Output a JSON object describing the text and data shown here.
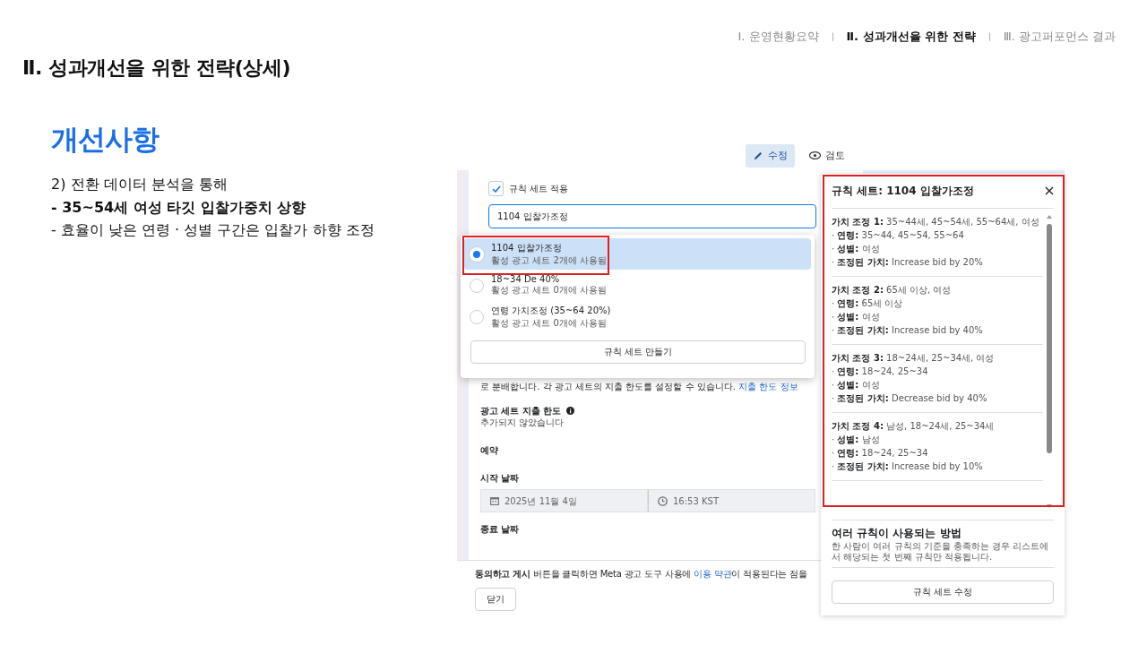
{
  "nav": {
    "items": [
      {
        "label": "Ⅰ. 운영현황요약",
        "selected": false
      },
      {
        "label": "Ⅱ. 성과개선을 위한 전략",
        "selected": true
      },
      {
        "label": "Ⅲ. 광고퍼포먼스 결과",
        "selected": false
      }
    ],
    "separators": [
      "ㅣ",
      "ㅣ"
    ]
  },
  "title": "Ⅱ. 성과개선을 위한 전략(상세)",
  "section": {
    "heading": "개선사항",
    "points": [
      {
        "kind": "lead",
        "text": "2) 전환 데이터 분석을 통해"
      },
      {
        "kind": "strong",
        "text": "- 35~54세 여성 타깃 입찰가중치 상향"
      },
      {
        "kind": "plain",
        "text": "- 효율이 낮은 연령 · 성별 구간은 입찰가 하향 조정"
      }
    ]
  },
  "screen": {
    "mode_tabs": [
      {
        "label": "수정",
        "selected": true
      },
      {
        "label": "검토",
        "selected": false
      }
    ],
    "form": {
      "apply_rule_set": {
        "label": "규칙 세트 적용",
        "checked": true
      },
      "rule_set_field": {
        "value": "1104 입찰가조정"
      },
      "budget_note": "로 분배합니다. 각 광고 세트의 지출 한도를 설정할 수 있습니다. ",
      "budget_link": "지출 한도 정보",
      "spend_limit": {
        "label": "광고 세트 지출 한도",
        "value": "추가되지 않았습니다"
      },
      "schedule_heading": "예약",
      "start_label": "시작 날짜",
      "start_date": "2025년 11월 4일",
      "start_time": "16:53  KST",
      "end_label": "종료 날짜"
    },
    "footer": {
      "notice": "**동의하고 게시** 버튼을 클릭하면 Meta 광고 도구 사용에 ",
      "terms_link": "이용 약관",
      "notice_end": "이 적용된다는 점을",
      "close_button": "닫기"
    },
    "dropdown": {
      "options": [
        {
          "title": "1104 입찰가조정",
          "subtitle": "활성 광고 세트 2개에 사용됨",
          "selected": true
        },
        {
          "title": "18~34 De 40%",
          "subtitle": "활성 광고 세트 0개에 사용됨",
          "selected": false
        },
        {
          "title": "연령 가치조정 (35~64 20%)",
          "subtitle": "활성 광고 세트 0개에 사용됨",
          "selected": false
        }
      ],
      "create_button": "규칙 세트 만들기"
    },
    "panel": {
      "title": "규칙 세트: 1104 입찰가조정",
      "adjustments": [
        {
          "title": "**가치 조정 1:** 35~44세, 45~54세, 55~64세, 여성",
          "lines": [
            "· **연령:** 35~44, 45~54, 55~64",
            "· **성별:** 여성",
            "· **조정된 가치:** Increase bid by 20%"
          ]
        },
        {
          "title": "**가치 조정 2:** 65세 이상, 여성",
          "lines": [
            "· **연령:** 65세 이상",
            "· **성별:** 여성",
            "· **조정된 가치:** Increase bid by 40%"
          ]
        },
        {
          "title": "**가치 조정 3:** 18~24세, 25~34세, 여성",
          "lines": [
            "· **연령:** 18~24, 25~34",
            "· **성별:** 여성",
            "· **조정된 가치:** Decrease bid by 40%"
          ]
        },
        {
          "title": "**가치 조정 4:** 남성, 18~24세, 25~34세",
          "lines": [
            "· **성별:** 남성",
            "· **연령:** 18~24, 25~34",
            "· **조정된 가치:** Increase bid by 10%"
          ]
        }
      ],
      "help_title": "여러 규칙이 사용되는 방법",
      "help_text": "한 사람이 여러 규칙의 기준을 충족하는 경우 리스트에서 해당되는 첫 번째 규칙만 적용됩니다.",
      "edit_button": "규칙 세트 수정"
    }
  }
}
